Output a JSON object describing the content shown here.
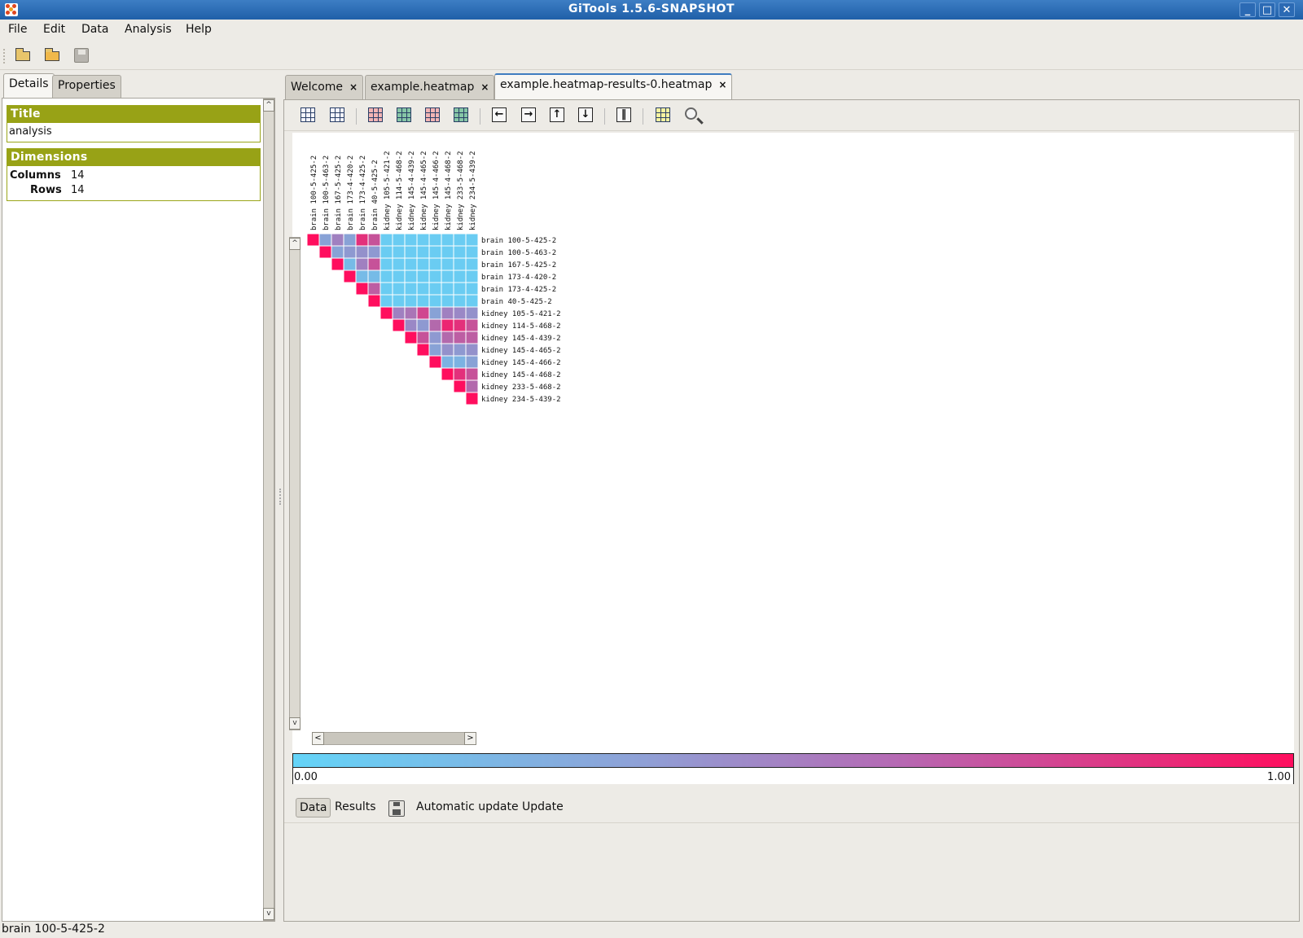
{
  "window": {
    "title": "GiTools 1.5.6-SNAPSHOT",
    "minimize": "_",
    "maximize": "□",
    "close": "✕"
  },
  "menu": [
    "File",
    "Edit",
    "Data",
    "Analysis",
    "Help"
  ],
  "toolbar": {
    "icons": [
      "open-folder-icon",
      "open-analysis-icon",
      "save-icon"
    ]
  },
  "left_panel": {
    "tabs": [
      "Details",
      "Properties"
    ],
    "title_section": {
      "header": "Title",
      "value": "analysis"
    },
    "dimensions_section": {
      "header": "Dimensions",
      "columns_label": "Columns",
      "columns_value": "14",
      "rows_label": "Rows",
      "rows_value": "14"
    }
  },
  "editor": {
    "tabs": [
      {
        "label": "Welcome",
        "close": "×"
      },
      {
        "label": "example.heatmap",
        "close": "×"
      },
      {
        "label": "example.heatmap-results-0.heatmap",
        "close": "×"
      }
    ]
  },
  "heatmap": {
    "columns": [
      "brain 100-5-425-2",
      "brain 100-5-463-2",
      "brain 167-5-425-2",
      "brain 173-4-420-2",
      "brain 173-4-425-2",
      "brain 40-5-425-2",
      "kidney 105-5-421-2",
      "kidney 114-5-468-2",
      "kidney 145-4-439-2",
      "kidney 145-4-465-2",
      "kidney 145-4-466-2",
      "kidney 145-4-468-2",
      "kidney 233-5-468-2",
      "kidney 234-5-439-2"
    ],
    "rows": [
      "brain 100-5-425-2",
      "brain 100-5-463-2",
      "brain 167-5-425-2",
      "brain 173-4-420-2",
      "brain 173-4-425-2",
      "brain 40-5-425-2",
      "kidney 105-5-421-2",
      "kidney 114-5-468-2",
      "kidney 145-4-439-2",
      "kidney 145-4-465-2",
      "kidney 145-4-466-2",
      "kidney 145-4-468-2",
      "kidney 233-5-468-2",
      "kidney 234-5-439-2"
    ],
    "values": [
      [
        1.0,
        0.3,
        0.5,
        0.3,
        0.85,
        0.7,
        0.05,
        0.05,
        0.05,
        0.05,
        0.05,
        0.05,
        0.05,
        0.05
      ],
      [
        null,
        1.0,
        0.3,
        0.35,
        0.4,
        0.35,
        0.05,
        0.05,
        0.05,
        0.05,
        0.05,
        0.05,
        0.05,
        0.05
      ],
      [
        null,
        null,
        1.0,
        0.15,
        0.5,
        0.7,
        0.05,
        0.05,
        0.05,
        0.05,
        0.05,
        0.05,
        0.05,
        0.05
      ],
      [
        null,
        null,
        null,
        1.0,
        0.15,
        0.15,
        0.05,
        0.05,
        0.05,
        0.05,
        0.05,
        0.05,
        0.05,
        0.05
      ],
      [
        null,
        null,
        null,
        null,
        1.0,
        0.65,
        0.05,
        0.05,
        0.05,
        0.05,
        0.05,
        0.05,
        0.05,
        0.05
      ],
      [
        null,
        null,
        null,
        null,
        null,
        1.0,
        0.05,
        0.05,
        0.05,
        0.05,
        0.05,
        0.05,
        0.05,
        0.05
      ],
      [
        null,
        null,
        null,
        null,
        null,
        null,
        1.0,
        0.5,
        0.55,
        0.75,
        0.3,
        0.5,
        0.45,
        0.4
      ],
      [
        null,
        null,
        null,
        null,
        null,
        null,
        null,
        1.0,
        0.45,
        0.35,
        0.6,
        0.9,
        0.85,
        0.7
      ],
      [
        null,
        null,
        null,
        null,
        null,
        null,
        null,
        null,
        1.0,
        0.7,
        0.35,
        0.6,
        0.65,
        0.65
      ],
      [
        null,
        null,
        null,
        null,
        null,
        null,
        null,
        null,
        null,
        1.0,
        0.3,
        0.4,
        0.35,
        0.4
      ],
      [
        null,
        null,
        null,
        null,
        null,
        null,
        null,
        null,
        null,
        null,
        1.0,
        0.2,
        0.2,
        0.3
      ],
      [
        null,
        null,
        null,
        null,
        null,
        null,
        null,
        null,
        null,
        null,
        null,
        1.0,
        0.85,
        0.7
      ],
      [
        null,
        null,
        null,
        null,
        null,
        null,
        null,
        null,
        null,
        null,
        null,
        null,
        1.0,
        0.6
      ],
      [
        null,
        null,
        null,
        null,
        null,
        null,
        null,
        null,
        null,
        null,
        null,
        null,
        null,
        1.0
      ]
    ],
    "color_low": "#64d4f8",
    "color_mid": "#a080c0",
    "color_high": "#ff0e5e"
  },
  "legend": {
    "min": "0.00",
    "max": "1.00"
  },
  "bottom_toolbar": {
    "data": "Data",
    "results": "Results",
    "auto_update": "Automatic update",
    "update": "Update"
  },
  "status": "brain 100-5-425-2"
}
